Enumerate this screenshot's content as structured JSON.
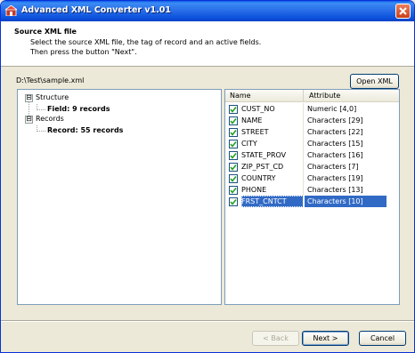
{
  "window": {
    "title": "Advanced XML Converter v1.01"
  },
  "header": {
    "title": "Source XML file",
    "description": "Select the source XML file, the tag of record and an active fields.\nThen press the button \"Next\"."
  },
  "source": {
    "path": "D:\\Test\\sample.xml",
    "open_button": "Open XML"
  },
  "tree": {
    "structure": {
      "label": "Structure",
      "child": "Field: 9 records"
    },
    "records": {
      "label": "Records",
      "child": "Record: 55 records"
    },
    "expander_symbol": "⊟"
  },
  "grid": {
    "columns": {
      "name": "Name",
      "attribute": "Attribute"
    },
    "rows": [
      {
        "name": "CUST_NO",
        "attribute": "Numeric [4,0]",
        "checked": true
      },
      {
        "name": "NAME",
        "attribute": "Characters [29]",
        "checked": true
      },
      {
        "name": "STREET",
        "attribute": "Characters [22]",
        "checked": true
      },
      {
        "name": "CITY",
        "attribute": "Characters [15]",
        "checked": true
      },
      {
        "name": "STATE_PROV",
        "attribute": "Characters [16]",
        "checked": true
      },
      {
        "name": "ZIP_PST_CD",
        "attribute": "Characters [7]",
        "checked": true
      },
      {
        "name": "COUNTRY",
        "attribute": "Characters [19]",
        "checked": true
      },
      {
        "name": "PHONE",
        "attribute": "Characters [13]",
        "checked": true
      },
      {
        "name": "FRST_CNTCT",
        "attribute": "Characters [10]",
        "checked": true,
        "selected": true
      }
    ]
  },
  "footer": {
    "back": "< Back",
    "next": "Next >",
    "cancel": "Cancel"
  },
  "colors": {
    "titlebar": "#0a5ce6",
    "selection": "#316ac5",
    "checkmark": "#21a121"
  }
}
